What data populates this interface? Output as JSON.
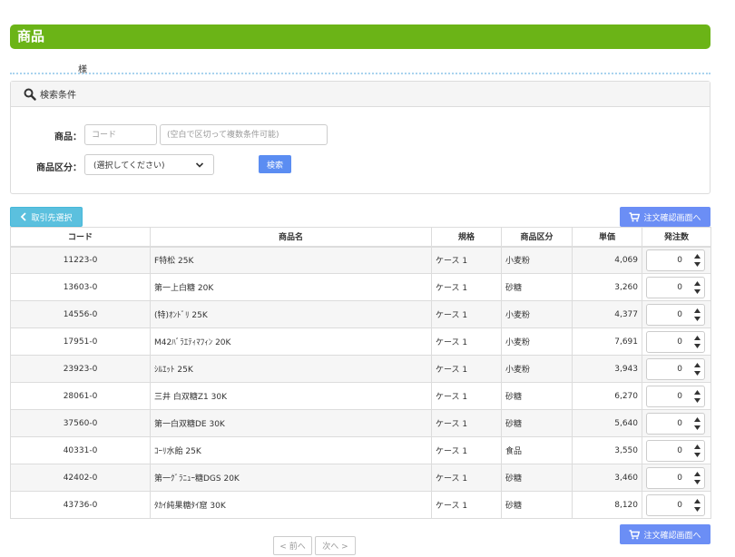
{
  "page": {
    "title": "商品",
    "customer_suffix": "様"
  },
  "search": {
    "header": "検索条件",
    "product_label": "商品：",
    "code_placeholder": "コード",
    "name_placeholder": "(空白で区切って複数条件可能)",
    "category_label": "商品区分：",
    "category_selected": "(選択してください)",
    "search_button": "検索"
  },
  "toolbar": {
    "back_button": "取引先選択",
    "confirm_button": "注文確認画面へ"
  },
  "table": {
    "headers": [
      "コード",
      "商品名",
      "規格",
      "商品区分",
      "単価",
      "発注数"
    ],
    "rows": [
      {
        "code": "11223-0",
        "name": "F特松 25K",
        "spec": "ケース 1",
        "category": "小麦粉",
        "price": "4,069",
        "qty": "0"
      },
      {
        "code": "13603-0",
        "name": "第一上白糖 20K",
        "spec": "ケース 1",
        "category": "砂糖",
        "price": "3,260",
        "qty": "0"
      },
      {
        "code": "14556-0",
        "name": "(特)ｵﾝﾄﾞﾘ 25K",
        "spec": "ケース 1",
        "category": "小麦粉",
        "price": "4,377",
        "qty": "0"
      },
      {
        "code": "17951-0",
        "name": "M42ﾊﾞﾗｴﾃｨﾏﾌｨﾝ 20K",
        "spec": "ケース 1",
        "category": "小麦粉",
        "price": "7,691",
        "qty": "0"
      },
      {
        "code": "23923-0",
        "name": "ｼﾙｴｯﾄ 25K",
        "spec": "ケース 1",
        "category": "小麦粉",
        "price": "3,943",
        "qty": "0"
      },
      {
        "code": "28061-0",
        "name": "三井 白双糖Z1 30K",
        "spec": "ケース 1",
        "category": "砂糖",
        "price": "6,270",
        "qty": "0"
      },
      {
        "code": "37560-0",
        "name": "第一白双糖DE 30K",
        "spec": "ケース 1",
        "category": "砂糖",
        "price": "5,640",
        "qty": "0"
      },
      {
        "code": "40331-0",
        "name": "ｺｰﾘ水飴 25K",
        "spec": "ケース 1",
        "category": "食品",
        "price": "3,550",
        "qty": "0"
      },
      {
        "code": "42402-0",
        "name": "第一ｸﾞﾗﾆｭｰ糖DGS 20K",
        "spec": "ケース 1",
        "category": "砂糖",
        "price": "3,460",
        "qty": "0"
      },
      {
        "code": "43736-0",
        "name": "ﾀｶｲ純果糖ﾀｲ窟 30K",
        "spec": "ケース 1",
        "category": "砂糖",
        "price": "8,120",
        "qty": "0"
      }
    ]
  },
  "pager": {
    "prev": "< 前へ",
    "next": "次へ >"
  },
  "colors": {
    "title_bar": "#6bb417",
    "button_blue": "#6b8ef5",
    "button_cyan": "#5bc0de"
  }
}
